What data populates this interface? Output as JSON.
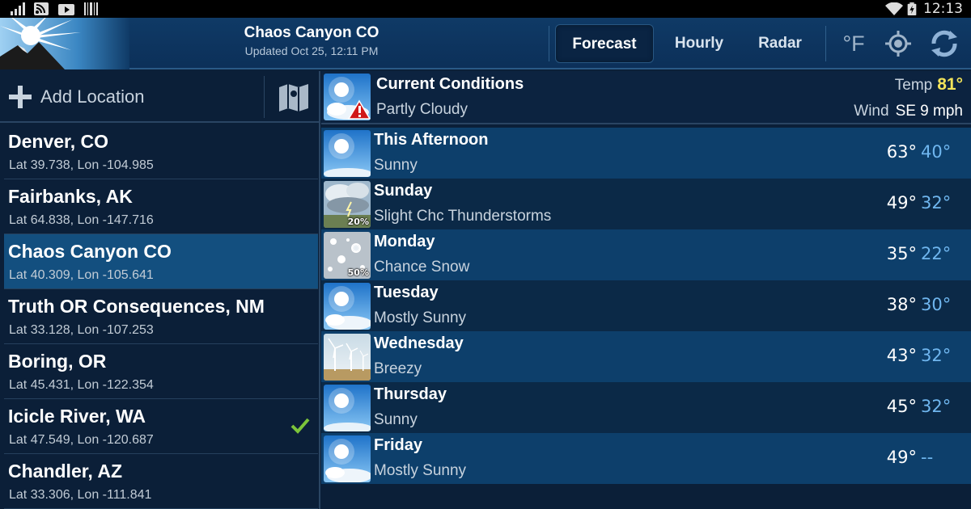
{
  "status_bar": {
    "time": "12:13"
  },
  "header": {
    "title": "Chaos Canyon CO",
    "subtitle": "Updated Oct 25, 12:11 PM",
    "tabs": [
      {
        "label": "Forecast",
        "active": true
      },
      {
        "label": "Hourly",
        "active": false
      },
      {
        "label": "Radar",
        "active": false
      }
    ],
    "unit_label": "°F"
  },
  "sidebar": {
    "add_label": "Add Location",
    "items": [
      {
        "name": "Denver, CO",
        "coords": "Lat 39.738, Lon -104.985",
        "selected": false,
        "checked": false
      },
      {
        "name": "Fairbanks, AK",
        "coords": "Lat 64.838, Lon -147.716",
        "selected": false,
        "checked": false
      },
      {
        "name": "Chaos Canyon CO",
        "coords": "Lat 40.309, Lon -105.641",
        "selected": true,
        "checked": false
      },
      {
        "name": "Truth OR Consequences, NM",
        "coords": "Lat 33.128, Lon -107.253",
        "selected": false,
        "checked": false
      },
      {
        "name": "Boring, OR",
        "coords": "Lat 45.431, Lon -122.354",
        "selected": false,
        "checked": false
      },
      {
        "name": "Icicle River, WA",
        "coords": "Lat 47.549, Lon -120.687",
        "selected": false,
        "checked": true
      },
      {
        "name": "Chandler, AZ",
        "coords": "Lat 33.306, Lon -111.841",
        "selected": false,
        "checked": false
      }
    ]
  },
  "current": {
    "title": "Current Conditions",
    "desc": "Partly Cloudy",
    "temp_label": "Temp",
    "temp_value": "81°",
    "wind_label": "Wind",
    "wind_value": "SE 9 mph",
    "icon": "partly-cloudy-alert-icon"
  },
  "forecast": [
    {
      "day": "This Afternoon",
      "desc": "Sunny",
      "hi": "63°",
      "lo": "40°",
      "icon": "sunny",
      "pct": ""
    },
    {
      "day": "Sunday",
      "desc": "Slight Chc Thunderstorms",
      "hi": "49°",
      "lo": "32°",
      "icon": "thunder",
      "pct": "20%"
    },
    {
      "day": "Monday",
      "desc": "Chance Snow",
      "hi": "35°",
      "lo": "22°",
      "icon": "snow",
      "pct": "50%"
    },
    {
      "day": "Tuesday",
      "desc": "Mostly Sunny",
      "hi": "38°",
      "lo": "30°",
      "icon": "mostly-sunny",
      "pct": ""
    },
    {
      "day": "Wednesday",
      "desc": "Breezy",
      "hi": "43°",
      "lo": "32°",
      "icon": "breezy",
      "pct": ""
    },
    {
      "day": "Thursday",
      "desc": "Sunny",
      "hi": "45°",
      "lo": "32°",
      "icon": "sunny",
      "pct": ""
    },
    {
      "day": "Friday",
      "desc": "Mostly Sunny",
      "hi": "49°",
      "lo": "--",
      "icon": "mostly-sunny",
      "pct": ""
    }
  ],
  "colors": {
    "accent_temp": "#f2e35a",
    "low_temp": "#6fb6ef",
    "selected_row": "#134f7f",
    "check": "#7cc43a"
  }
}
